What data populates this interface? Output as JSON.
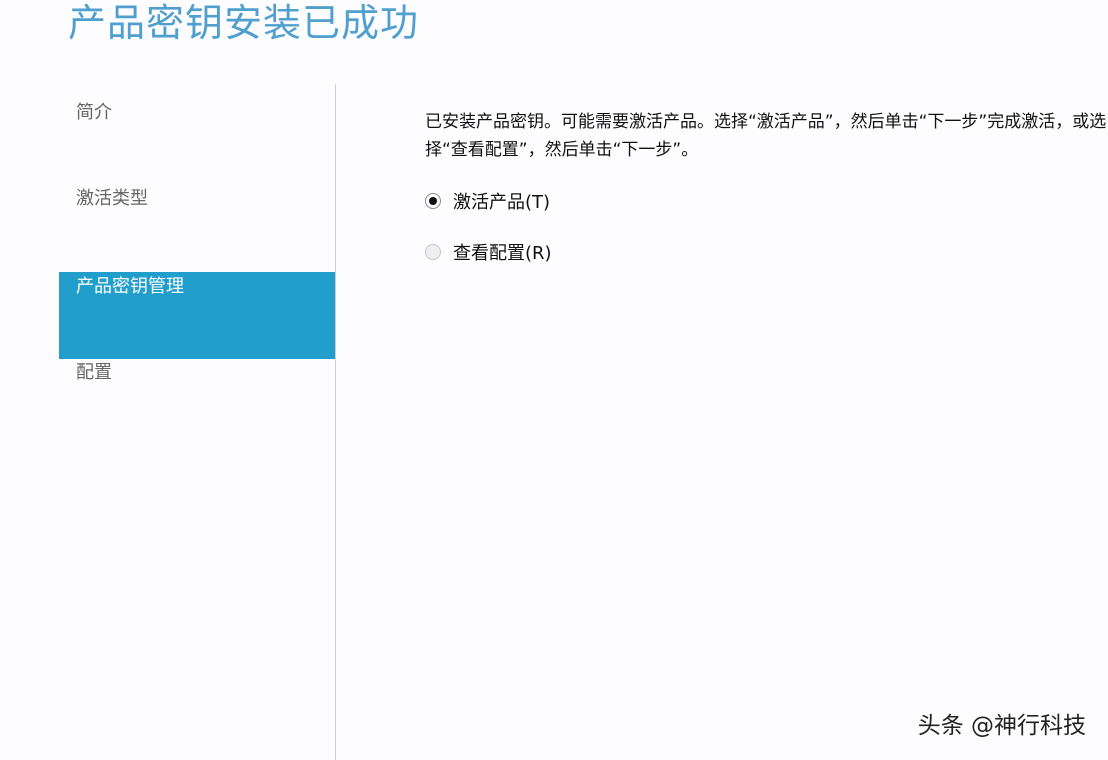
{
  "page": {
    "title": "产品密钥安装已成功"
  },
  "sidebar": {
    "items": [
      {
        "label": "简介",
        "active": false
      },
      {
        "label": "激活类型",
        "active": false
      },
      {
        "label": "产品密钥管理",
        "active": true
      },
      {
        "label": "配置",
        "active": false
      }
    ]
  },
  "main": {
    "description": "已安装产品密钥。可能需要激活产品。选择“激活产品”，然后单击“下一步”完成激活，或选择“查看配置”，然后单击“下一步”。",
    "options": [
      {
        "label": "激活产品(T)",
        "checked": true
      },
      {
        "label": "查看配置(R)",
        "checked": false
      }
    ]
  },
  "watermark": {
    "text": "头条 @神行科技"
  },
  "colors": {
    "accent": "#229ecc",
    "title": "#4f9fcf"
  }
}
